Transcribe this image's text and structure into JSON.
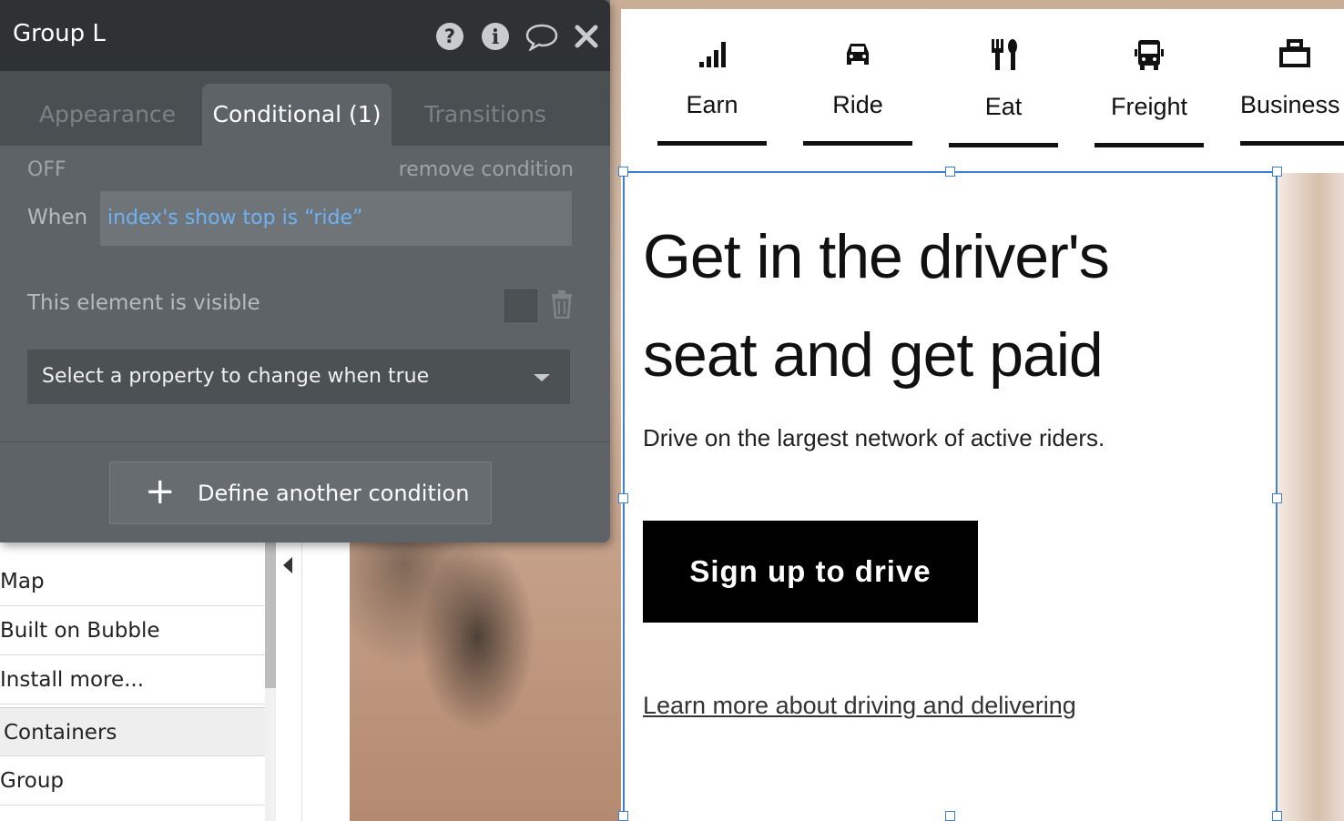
{
  "palette": {
    "items": [
      {
        "label": "Map"
      },
      {
        "label": "Built on Bubble"
      },
      {
        "label": "Install more..."
      }
    ],
    "section_label": "Containers",
    "after_section": [
      {
        "label": "Group"
      }
    ]
  },
  "property_editor": {
    "title": "Group L",
    "tabs": [
      {
        "label": "Appearance",
        "active": false
      },
      {
        "label": "Conditional (1)",
        "active": true
      },
      {
        "label": "Transitions",
        "active": false
      }
    ],
    "condition": {
      "state": "OFF",
      "remove_label": "remove condition",
      "when_label": "When",
      "expression": "index's show top is “ride”",
      "property_label": "This element is visible",
      "property_checked": false,
      "select_placeholder": "Select a property to change when true"
    },
    "define_button": "Define another condition",
    "icons": [
      "help-icon",
      "info-icon",
      "comment-icon",
      "close-icon",
      "trash-icon",
      "plus-icon"
    ]
  },
  "page": {
    "nav": [
      {
        "label": "Earn",
        "icon": "signal-bars-icon"
      },
      {
        "label": "Ride",
        "icon": "car-icon"
      },
      {
        "label": "Eat",
        "icon": "fork-knife-icon"
      },
      {
        "label": "Freight",
        "icon": "truck-icon"
      },
      {
        "label": "Business",
        "icon": "briefcase-icon"
      }
    ],
    "hero_title_line1": "Get in the driver's",
    "hero_title_line2": "seat and get paid",
    "hero_subtitle": "Drive on the largest network of active riders.",
    "cta_label": "Sign up to drive",
    "link_label": "Learn more about driving and delivering"
  },
  "colors": {
    "panel_bg": "#5d6367",
    "header_bg": "#2e3235",
    "expression_text": "#6fb2f2",
    "selection": "#3d7fd6",
    "cta_bg": "#000000"
  }
}
